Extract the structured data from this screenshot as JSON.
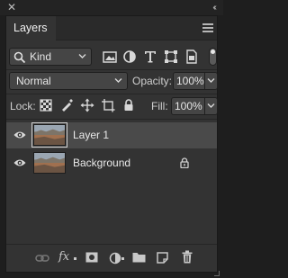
{
  "window": {
    "close_glyph": "✕",
    "collapse_glyph": "‹‹"
  },
  "panel": {
    "tab_label": "Layers",
    "menu_icon": "panel-menu-icon"
  },
  "filter": {
    "kind_label": "Kind",
    "icons": [
      "image-filter-icon",
      "adjustment-filter-icon",
      "type-filter-icon",
      "shape-filter-icon",
      "smart-object-filter-icon"
    ],
    "toggle_on": true
  },
  "blend": {
    "mode_value": "Normal",
    "opacity_label": "Opacity:",
    "opacity_value": "100%"
  },
  "lock": {
    "label": "Lock:",
    "icons": [
      "lock-transparent-pixels-icon",
      "lock-image-pixels-icon",
      "lock-position-icon",
      "lock-artboard-icon",
      "lock-all-icon"
    ],
    "fill_label": "Fill:",
    "fill_value": "100%"
  },
  "layers": [
    {
      "name": "Layer 1",
      "visible": true,
      "selected": true,
      "locked": false
    },
    {
      "name": "Background",
      "visible": true,
      "selected": false,
      "locked": true
    }
  ],
  "footer": {
    "fx_label": "fx",
    "icons": [
      "link-layers-icon",
      "layer-style-icon",
      "layer-mask-icon",
      "adjustment-layer-icon",
      "group-folder-icon",
      "new-layer-icon",
      "trash-icon"
    ]
  },
  "colors": {
    "panel_bg": "#333333",
    "selected_row": "#4a4a4a",
    "input_bg": "#454545"
  }
}
